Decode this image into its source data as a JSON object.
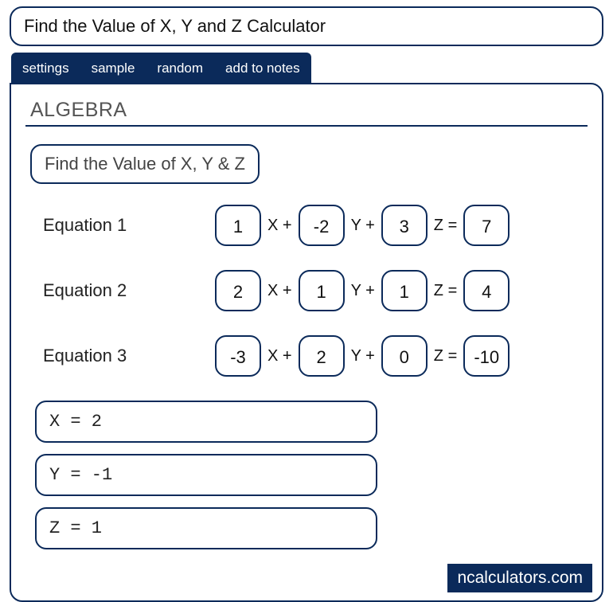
{
  "title": "Find the Value of X, Y and Z Calculator",
  "tabs": {
    "settings": "settings",
    "sample": "sample",
    "random": "random",
    "add_to_notes": "add to notes"
  },
  "section": "ALGEBRA",
  "subtitle": "Find the Value of X, Y & Z",
  "labels": {
    "eq1": "Equation 1",
    "eq2": "Equation 2",
    "eq3": "Equation 3"
  },
  "symbols": {
    "xplus": "X +",
    "yplus": "Y +",
    "zeq": "Z ="
  },
  "equations": {
    "eq1": {
      "a": "1",
      "b": "-2",
      "c": "3",
      "d": "7"
    },
    "eq2": {
      "a": "2",
      "b": "1",
      "c": "1",
      "d": "4"
    },
    "eq3": {
      "a": "-3",
      "b": "2",
      "c": "0",
      "d": "-10"
    }
  },
  "results": {
    "x": "X = 2",
    "y": "Y = -1",
    "z": "Z = 1"
  },
  "brand": "ncalculators.com"
}
